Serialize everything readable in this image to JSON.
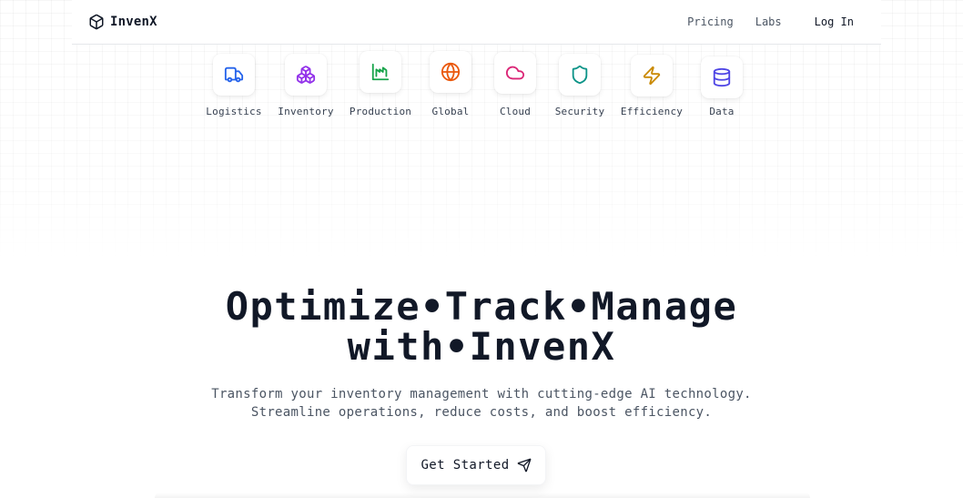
{
  "brand": {
    "name": "InvenX",
    "icon": "cube-icon"
  },
  "nav": {
    "pricing": "Pricing",
    "labs": "Labs",
    "login": "Log In"
  },
  "features": [
    {
      "label": "Logistics",
      "icon": "truck-icon",
      "color": "#2563eb"
    },
    {
      "label": "Inventory",
      "icon": "boxes-icon",
      "color": "#9333ea"
    },
    {
      "label": "Production",
      "icon": "factory-icon",
      "color": "#16a34a"
    },
    {
      "label": "Global",
      "icon": "globe-icon",
      "color": "#ea580c"
    },
    {
      "label": "Cloud",
      "icon": "cloud-icon",
      "color": "#db2777"
    },
    {
      "label": "Security",
      "icon": "shield-icon",
      "color": "#0d9488"
    },
    {
      "label": "Efficiency",
      "icon": "zap-icon",
      "color": "#ca8a04"
    },
    {
      "label": "Data",
      "icon": "database-icon",
      "color": "#4f46e5"
    }
  ],
  "hero": {
    "title_line1": "Optimize•Track•Manage",
    "title_line2": "with•InvenX",
    "subtitle_line1": "Transform your inventory management with cutting-edge AI technology.",
    "subtitle_line2": "Streamline operations, reduce costs, and boost efficiency."
  },
  "cta": {
    "label": "Get Started",
    "icon": "send-icon"
  }
}
